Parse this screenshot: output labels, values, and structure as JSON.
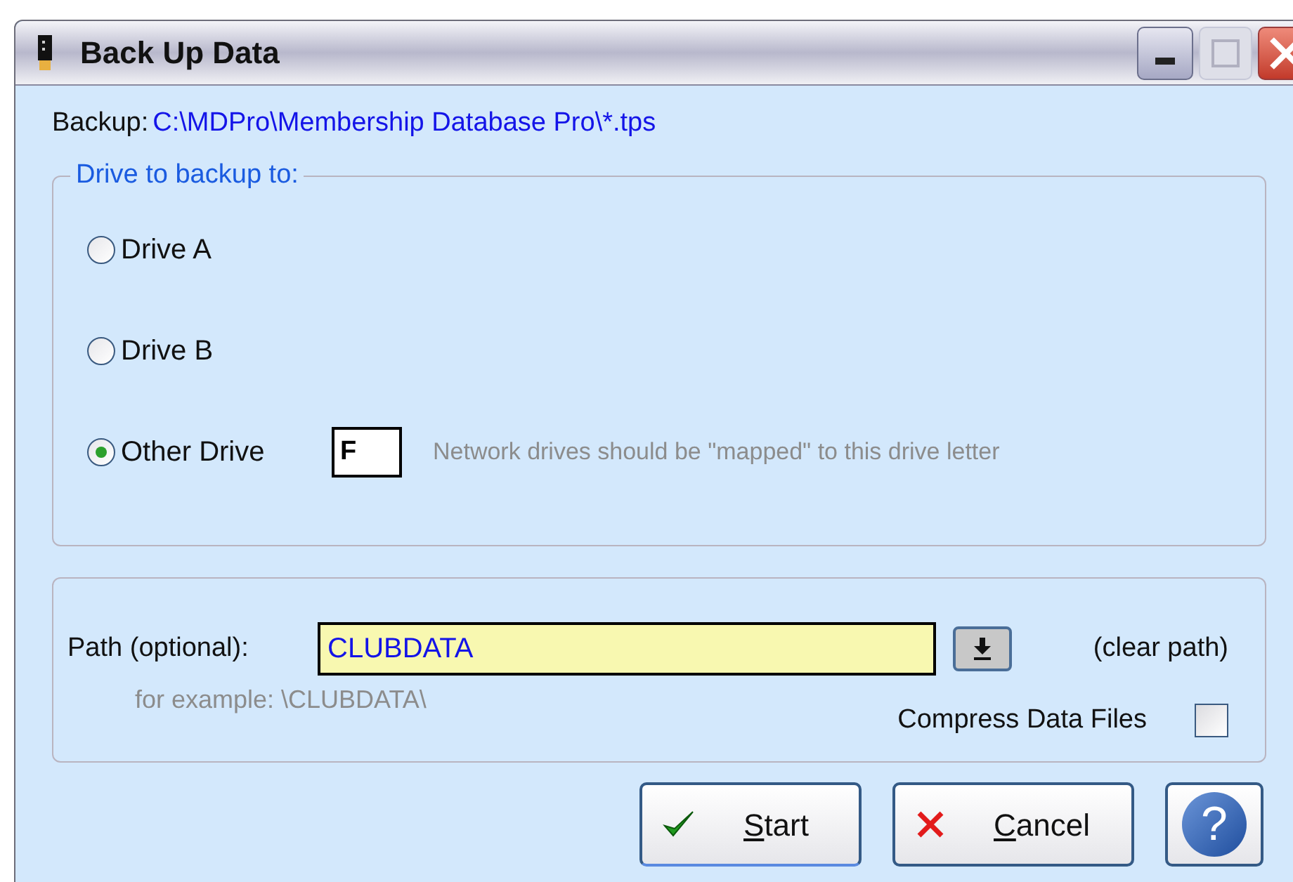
{
  "window": {
    "title": "Back Up Data"
  },
  "backup": {
    "label": "Backup:",
    "path": "C:\\MDPro\\Membership Database Pro\\*.tps"
  },
  "drive_group": {
    "legend": "Drive to backup to:",
    "options": [
      {
        "label": "Drive A",
        "selected": false
      },
      {
        "label": "Drive B",
        "selected": false
      },
      {
        "label": "Other Drive",
        "selected": true
      }
    ],
    "drive_letter": "F",
    "note": "Network drives should be \"mapped\" to this drive letter"
  },
  "path": {
    "label": "Path (optional):",
    "value": "CLUBDATA",
    "clear": "(clear path)",
    "example": "for example: \\CLUBDATA\\"
  },
  "compress": {
    "label": "Compress Data Files",
    "checked": false
  },
  "buttons": [
    {
      "kind": "ok",
      "label": "Start"
    },
    {
      "kind": "cancel",
      "label": "Cancel"
    },
    {
      "kind": "help",
      "label": "?"
    }
  ]
}
